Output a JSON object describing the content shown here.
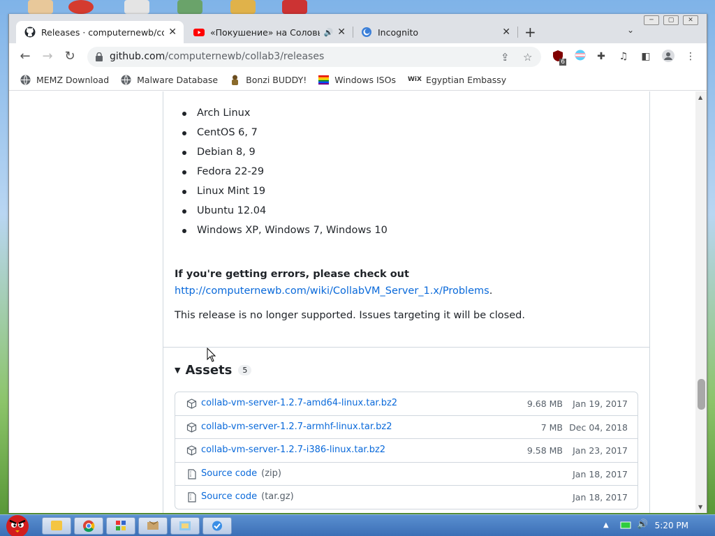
{
  "browser": {
    "tabs": [
      {
        "title": "Releases · computernewb/colla",
        "active": true
      },
      {
        "title": "«Покушение» на Соловь",
        "active": false
      },
      {
        "title": "Incognito",
        "active": false
      }
    ],
    "url_host": "github.com",
    "url_path": "/computernewb/collab3/releases",
    "extension_badge": "6",
    "bookmarks": [
      {
        "label": "MEMZ Download"
      },
      {
        "label": "Malware Database"
      },
      {
        "label": "Bonzi BUDDY!"
      },
      {
        "label": "Windows ISOs"
      },
      {
        "label": "Egyptian Embassy"
      }
    ]
  },
  "release": {
    "os_list": [
      "Arch Linux",
      "CentOS 6, 7",
      "Debian 8, 9",
      "Fedora 22-29",
      "Linux Mint 19",
      "Ubuntu 12.04",
      "Windows XP, Windows 7, Windows 10"
    ],
    "errors_text": "If you're getting errors, please check out",
    "errors_link": "http://computernewb.com/wiki/CollabVM_Server_1.x/Problems",
    "unsupported_note": "This release is no longer supported. Issues targeting it will be closed.",
    "assets_title": "Assets",
    "assets_count": "5",
    "assets": [
      {
        "name": "collab-vm-server-1.2.7-amd64-linux.tar.bz2",
        "ext": "",
        "size": "9.68 MB",
        "date": "Jan 19, 2017"
      },
      {
        "name": "collab-vm-server-1.2.7-armhf-linux.tar.bz2",
        "ext": "",
        "size": "7 MB",
        "date": "Dec 04, 2018"
      },
      {
        "name": "collab-vm-server-1.2.7-i386-linux.tar.bz2",
        "ext": "",
        "size": "9.58 MB",
        "date": "Jan 23, 2017"
      },
      {
        "name": "Source code",
        "ext": "(zip)",
        "size": "",
        "date": "Jan 18, 2017"
      },
      {
        "name": "Source code",
        "ext": "(tar.gz)",
        "size": "",
        "date": "Jan 18, 2017"
      }
    ]
  },
  "taskbar": {
    "clock": "5:20 PM"
  }
}
